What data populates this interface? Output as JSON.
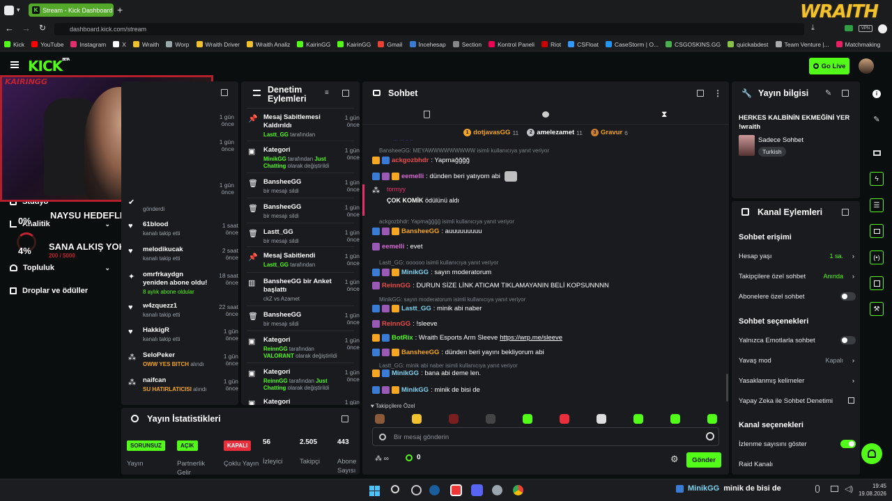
{
  "browser": {
    "tab_title": "Stream - Kick Dashboard",
    "url": "dashboard.kick.com/stream",
    "bookmarks": [
      "Kick",
      "YouTube",
      "Instagram",
      "X",
      "Wraith",
      "Worp",
      "Wraith Driver",
      "Wraith Analiz",
      "KairinGG",
      "KairinGG",
      "Gmail",
      "İncehesap",
      "Section",
      "Kontrol Paneli",
      "Riot",
      "CSFloat",
      "CaseStorm | O...",
      "CSGOSKINS.GG",
      "quickabdest",
      "Team Venture |...",
      "Matchmaking"
    ],
    "overlay_logo": "WRAITH"
  },
  "header": {
    "go_live": "Go Live",
    "logo": "KICK",
    "logo_sup": "BETA"
  },
  "left_nav": {
    "studio": "Stüdyo",
    "analytics": "Analitik",
    "community": "Topluluk",
    "drops": "Droplar ve ödüller"
  },
  "overlay": {
    "cam_name": "KAIRINGG",
    "goal1": "NAYSU HEDEFLER",
    "goal2": "SANA ALKIŞ YOK ANCAK KICK",
    "pct1": "0%",
    "pct2": "4%",
    "progress": "200 / 5000"
  },
  "activity": {
    "items": [
      {
        "name": "",
        "desc": "gönderdi",
        "time": ""
      },
      {
        "name": "61blood",
        "desc": "kanalı takip etti",
        "time": "1 saat önce"
      },
      {
        "name": "melodikucak",
        "desc": "kanalı takip etti",
        "time": "2 saat önce"
      },
      {
        "name": "omrfrkaydgn yeniden abone oldu!",
        "desc": "8 aylık abone oldular",
        "time": "18 saat önce"
      },
      {
        "name": "w4zquezz1",
        "desc": "kanalı takip etti",
        "time": "22 saat önce"
      },
      {
        "name": "HakkigR",
        "desc": "kanalı takip etti",
        "time": "1 gün önce"
      },
      {
        "name": "SeloPeker",
        "desc": "OWW YES BITCH",
        "desc2": "alındı",
        "time": "1 gün önce"
      },
      {
        "name": "naifcan",
        "desc": "SU HATIRLATICISI",
        "desc2": "alındı",
        "time": "1 gün önce"
      }
    ],
    "partial_times": [
      "1 gün önce",
      "1 gün önce",
      "1 gün önce"
    ]
  },
  "moderation": {
    "title": "Denetim Eylemleri",
    "items": [
      {
        "title": "Mesaj Sabitlemesi Kaldırıldı",
        "user": "Lastt_GG",
        "rest": "tarafından",
        "time": "1 gün önce"
      },
      {
        "title": "Kategori",
        "user": "MinikGG",
        "rest": "tarafından",
        "extra": "Just Chatting",
        "rest2": "olarak değiştirildi",
        "time": "1 gün önce"
      },
      {
        "title": "BansheeGG",
        "sub": "bir mesajı sildi",
        "time": "1 gün önce"
      },
      {
        "title": "BansheeGG",
        "sub": "bir mesajı sildi",
        "time": "1 gün önce"
      },
      {
        "title": "Lastt_GG",
        "sub": "bir mesajı sildi",
        "time": "1 gün önce"
      },
      {
        "title": "Mesaj Sabitlendi",
        "user": "Lastt_GG",
        "rest": "tarafından",
        "time": "1 gün önce"
      },
      {
        "title": "BansheeGG bir Anket başlattı",
        "sub": "ckZ vs Azamet",
        "time": "1 gün önce"
      },
      {
        "title": "BansheeGG",
        "sub": "bir mesajı sildi",
        "time": "1 gün önce"
      },
      {
        "title": "Kategori",
        "user": "ReinnGG",
        "rest": "tarafından",
        "extra": "VALORANT",
        "rest2": "olarak değiştirildi",
        "time": "1 gün önce"
      },
      {
        "title": "Kategori",
        "user": "ReinnGG",
        "rest": "tarafından",
        "extra": "Just Chatting",
        "rest2": "olarak değiştirildi",
        "time": "1 gün önce"
      },
      {
        "title": "Kategori",
        "sub": "",
        "time": "1 gün önce"
      }
    ]
  },
  "stats": {
    "title": "Yayın İstatistikleri",
    "cols": [
      {
        "badge": "SORUNSUZ",
        "label": "Yayın"
      },
      {
        "badge": "AÇIK",
        "label": "Partnerlik Gelir"
      },
      {
        "badge": "KAPALI",
        "label": "Çoklu Yayın"
      },
      {
        "value": "56",
        "label": "İzleyici"
      },
      {
        "value": "2.505",
        "label": "Takipçi"
      },
      {
        "value": "443",
        "label": "Abone Sayısı"
      }
    ]
  },
  "chat": {
    "title": "Sohbet",
    "top": [
      {
        "name": "dotjavasGG",
        "n": "11",
        "rank": "1"
      },
      {
        "name": "amelezamet",
        "n": "11",
        "rank": "2"
      },
      {
        "name": "Gravur",
        "n": "6",
        "rank": "3"
      }
    ],
    "partial": "... ... .. ..",
    "lines": [
      {
        "reply": "BansheeGG: MEYAWWWWWWWWW isimli kullanıcıya yanıt veriyor"
      },
      {
        "user": "ackgozbhdr",
        "color": "#ea4c4c",
        "text": ": Yapmağğğğ"
      },
      {
        "user": "eemelli",
        "color": "#d96bd6",
        "text": ": dünden beri yatıyom abi"
      },
      {
        "reward_user": "tormyy",
        "reward_text": "ÇOK KOMİK",
        "reward_rest": "ödülünü aldı"
      },
      {
        "reply": "ackgozbhdr: Yapmağğğğ isimli kullanıcıya yanıt veriyor"
      },
      {
        "user": "BansheeGG",
        "color": "#f5a623",
        "text": ": auuuuuuuuu"
      },
      {
        "user": "eemelli",
        "color": "#d96bd6",
        "text": ": evet"
      },
      {
        "reply": "Lastt_GG: oooooo isimli kullanıcıya yanıt veriyor"
      },
      {
        "user": "MinikGG",
        "color": "#7fd3f0",
        "text": ": sayın moderatorum"
      },
      {
        "user": "ReinnGG",
        "color": "#ea4c4c",
        "text": ": DURUN SİZE LİNK ATICAM TIKLAMAYANIN BELİ KOPSUNNNN"
      },
      {
        "reply": "MinikGG: sayın moderatorum isimli kullanıcıya yanıt veriyor"
      },
      {
        "user": "Lastt_GG",
        "color": "#7fd3f0",
        "text": ": minik abi naber"
      },
      {
        "user": "ReinnGG",
        "color": "#ea4c4c",
        "text": ": !sleeve"
      },
      {
        "user": "BotRix",
        "color": "#53fc18",
        "text": ": Wraith Esports Arm Sleeve ",
        "link": "https://wrp.me/sleeve"
      },
      {
        "user": "BansheeGG",
        "color": "#f5a623",
        "text": ": dünden beri yayını bekliyorum abi"
      },
      {
        "reply": "Lastt_GG: minik abi naber isimli kullanıcıya yanıt veriyor"
      },
      {
        "user": "MinikGG",
        "color": "#7fd3f0",
        "text": ": bana abi deme len."
      },
      {
        "user": "MinikGG",
        "color": "#7fd3f0",
        "text": ": minik de bisi de"
      }
    ],
    "followers_only": "Takipçilere Özel",
    "input_placeholder": "Bir mesaj gönderin",
    "points": "0",
    "send": "Gönder"
  },
  "stream_info": {
    "title": "Yayın bilgisi",
    "stream_title": "HERKES KALBİNİN EKMEĞİNİ YER !wraith",
    "category": "Sadece Sohbet",
    "language": "Turkish"
  },
  "channel_actions": {
    "title": "Kanal Eylemleri",
    "chat_access": "Sohbet erişimi",
    "account_age": "Hesap yaşı",
    "account_age_val": "1 sa.",
    "followers_chat": "Takipçilere özel sohbet",
    "followers_chat_val": "Anında",
    "subs_chat": "Abonelere özel sohbet",
    "chat_options": "Sohbet seçenekleri",
    "emote_only": "Yalnızca Emotlarla sohbet",
    "slow_mode": "Yavaş mod",
    "slow_mode_val": "Kapalı",
    "banned_words": "Yasaklanmış kelimeler",
    "ai_mod": "Yapay Zeka ile Sohbet Denetimi",
    "channel_options": "Kanal seçenekleri",
    "show_viewers": "İzlenme sayısını göster",
    "raid": "Raid Kanalı"
  },
  "taskbar": {
    "ticker_user": "MinikGG",
    "ticker_text": "minik de bisi de",
    "time": "19:45",
    "date": "19.08.2026"
  },
  "colors": {
    "accent": "#53fc18",
    "panel": "#191b1f",
    "bg": "#0b0e0f"
  }
}
